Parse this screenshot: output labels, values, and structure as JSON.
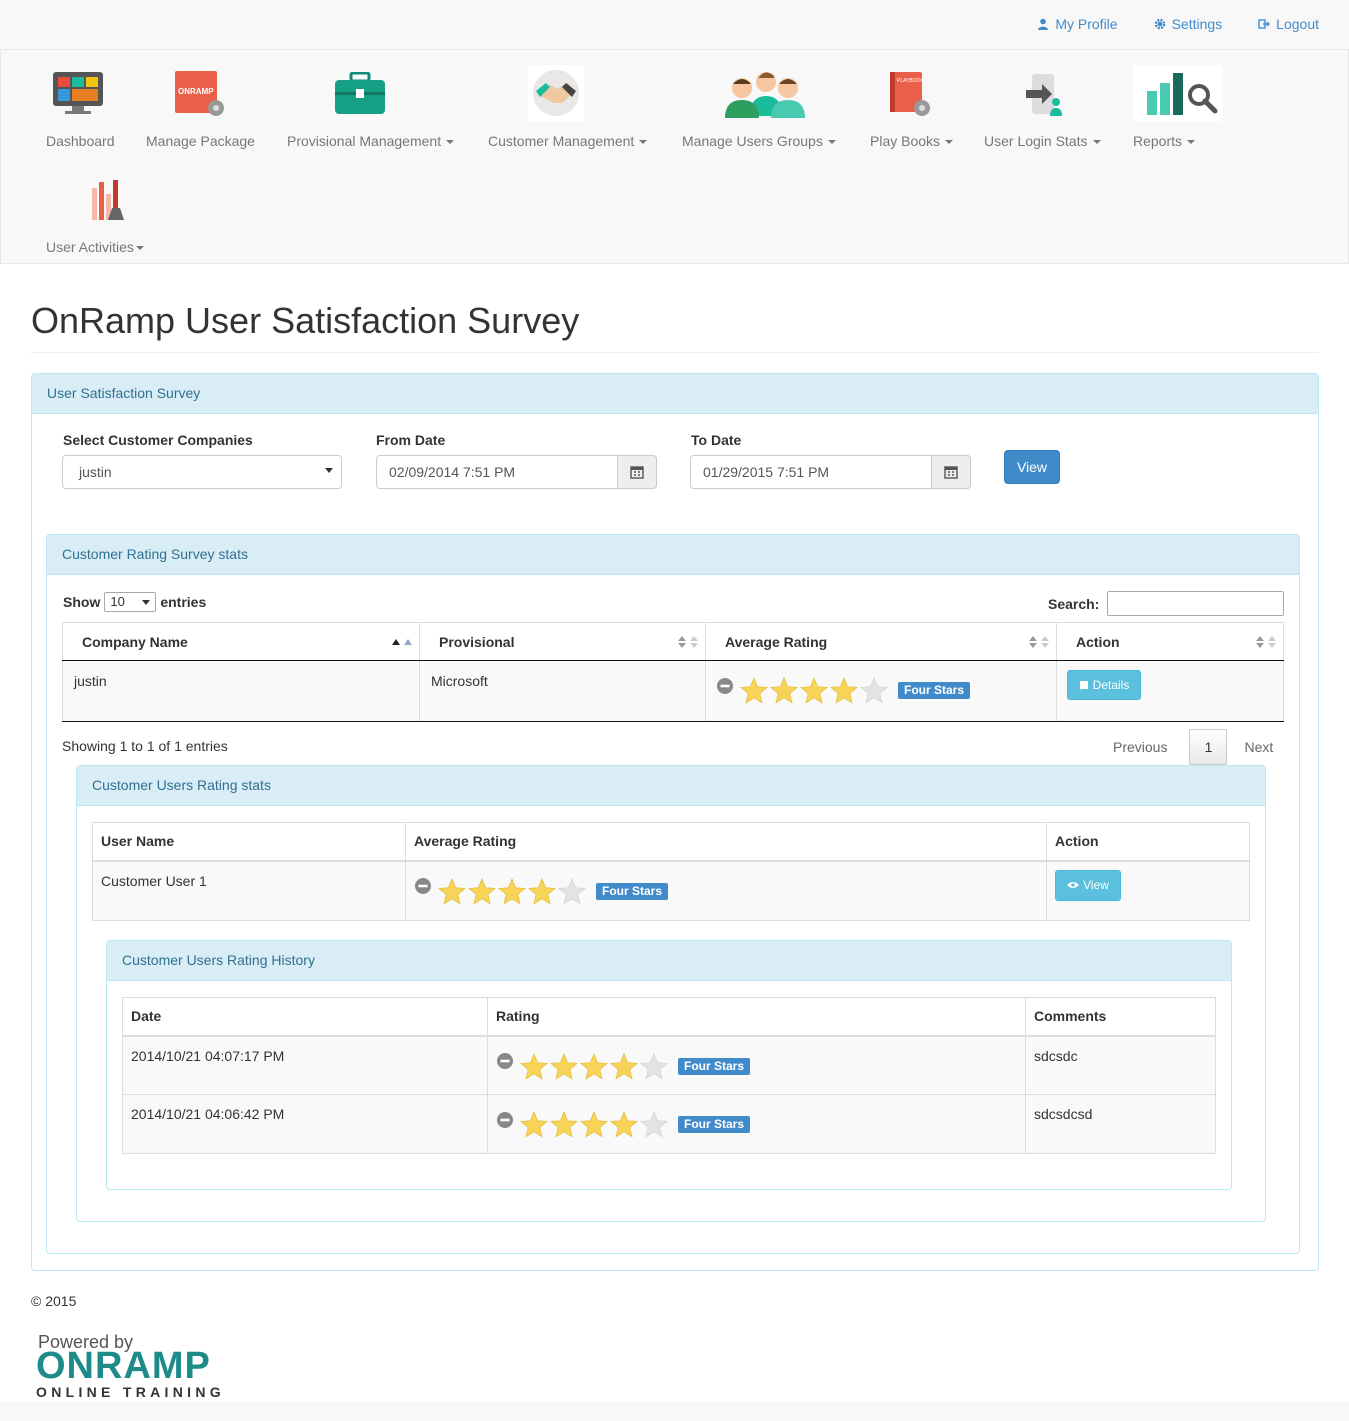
{
  "topbar": {
    "my_profile": "My Profile",
    "settings": "Settings",
    "logout": "Logout"
  },
  "nav": {
    "items": [
      {
        "label": "Dashboard",
        "icon": "dashboard-icon"
      },
      {
        "label": "Manage Package",
        "icon": "onramp-package-icon",
        "icon_text": "ONRAMP"
      },
      {
        "label": "Provisional Management",
        "icon": "briefcase-icon"
      },
      {
        "label": "Customer Management",
        "icon": "handshake-icon"
      },
      {
        "label": "Manage Users Groups",
        "icon": "users-group-icon"
      },
      {
        "label": "Play Books",
        "icon": "playbook-icon",
        "icon_text": "PLAYBOOK"
      },
      {
        "label": "User Login Stats",
        "icon": "login-icon"
      },
      {
        "label": "Reports",
        "icon": "reports-icon"
      },
      {
        "label": "User Activities",
        "icon": "activities-icon"
      }
    ]
  },
  "page_title": "OnRamp User Satisfaction Survey",
  "survey_panel": {
    "heading": "User Satisfaction Survey",
    "company_label": "Select Customer Companies",
    "company_value": "justin",
    "from_label": "From Date",
    "from_value": "02/09/2014 7:51 PM",
    "to_label": "To Date",
    "to_value": "01/29/2015 7:51 PM",
    "view_button": "View"
  },
  "rating_stats": {
    "heading": "Customer Rating Survey stats",
    "show_label": "Show",
    "page_size": "10",
    "entries_label": "entries",
    "search_label": "Search:",
    "search_value": "",
    "columns": [
      "Company Name",
      "Provisional",
      "Average Rating",
      "Action"
    ],
    "rows": [
      {
        "company": "justin",
        "provisional": "Microsoft",
        "rating": 4,
        "rating_label": "Four Stars",
        "action": "Details"
      }
    ],
    "info": "Showing 1 to 1 of 1 entries",
    "previous": "Previous",
    "page": "1",
    "next": "Next"
  },
  "users_stats": {
    "heading": "Customer Users Rating stats",
    "columns": [
      "User Name",
      "Average Rating",
      "Action"
    ],
    "rows": [
      {
        "user": "Customer User 1",
        "rating": 4,
        "rating_label": "Four Stars",
        "action": "View"
      }
    ]
  },
  "history": {
    "heading": "Customer Users Rating History",
    "columns": [
      "Date",
      "Rating",
      "Comments"
    ],
    "rows": [
      {
        "date": "2014/10/21 04:07:17 PM",
        "rating": 4,
        "rating_label": "Four Stars",
        "comment": "sdcsdc"
      },
      {
        "date": "2014/10/21 04:06:42 PM",
        "rating": 4,
        "rating_label": "Four Stars",
        "comment": "sdcsdcsd"
      }
    ]
  },
  "footer": {
    "copyright": "© 2015",
    "powered_by": "Powered by",
    "brand": "ONRAMP",
    "brand_sub": "ONLINE TRAINING"
  },
  "colors": {
    "link": "#428bca",
    "panel_heading_bg": "#d9edf7",
    "panel_heading_text": "#31708f",
    "star": "#f7d358",
    "brand_teal": "#1e8b8b"
  }
}
